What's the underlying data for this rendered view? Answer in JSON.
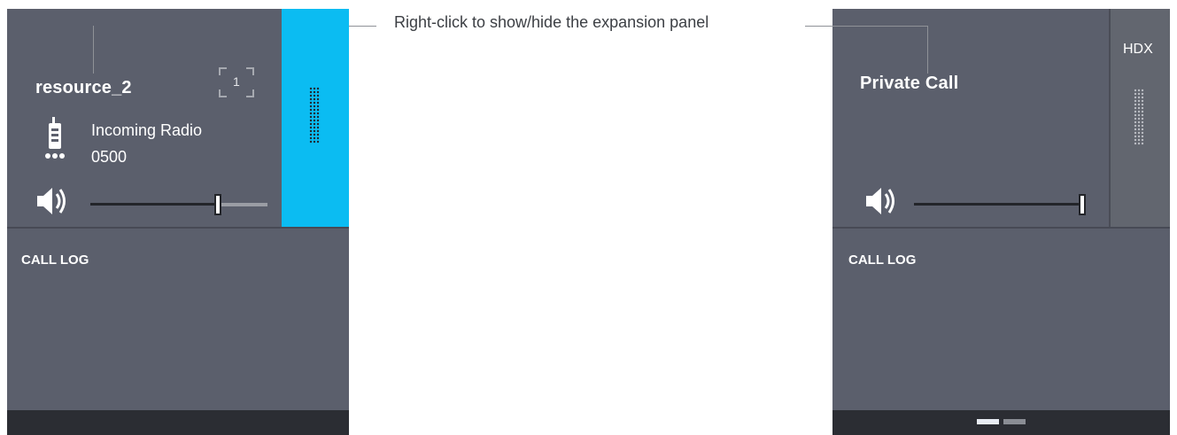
{
  "annotation": {
    "text": "Right-click to show/hide the expansion panel"
  },
  "left_panel": {
    "resource_name": "resource_2",
    "slot_number": "1",
    "status_line1": "Incoming Radio",
    "status_line2": "0500",
    "volume_level": 0.75,
    "call_log_label": "CALL LOG",
    "expansion_strip_color": "#0bbcf2"
  },
  "right_panel": {
    "call_type": "Private Call",
    "badge": "HDX",
    "volume_level": 1.0,
    "call_log_label": "CALL LOG",
    "page_indicator": {
      "pages": 2,
      "current": 1
    }
  },
  "colors": {
    "panel": "#5b5f6c",
    "accent": "#0bbcf2",
    "bottom_bar": "#2b2d33"
  },
  "icons": [
    "radio-icon",
    "speaker-icon",
    "grip-icon",
    "slot-frame-icon"
  ]
}
